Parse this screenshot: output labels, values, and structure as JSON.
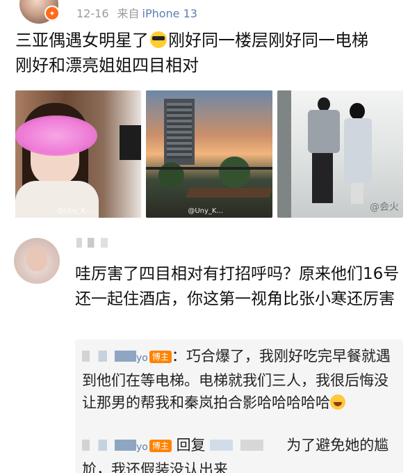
{
  "post": {
    "date": "12-16",
    "source_prefix": "来自",
    "device": "iPhone 13",
    "text_line1": "三亚偶遇女明星了",
    "text_line1_tail": "刚好同一楼层刚好同一电梯",
    "text_line2": "刚好和漂亮姐姐四目相对",
    "images": [
      {
        "watermark": "@Uny_K..."
      },
      {
        "watermark": "@Uny_K..."
      },
      {
        "watermark": "@会火"
      }
    ]
  },
  "comment": {
    "text": "哇厉害了四目相对有打招呼吗？原来他们16号还一起住酒店，你这第一视角比张小寒还厉害"
  },
  "replies": [
    {
      "name_suffix": "yo",
      "tag": "博主",
      "text_a": "：巧合爆了，我刚好吃完早餐就遇到他们在等电梯。电梯就我们三人，我很后悔没让那男的帮我和秦岚拍合影哈哈哈哈哈"
    },
    {
      "name_suffix": "yo",
      "tag": "博主",
      "reply_word": "回复",
      "text_a": "为了避免她的尴尬，我还假装没认出来"
    }
  ]
}
